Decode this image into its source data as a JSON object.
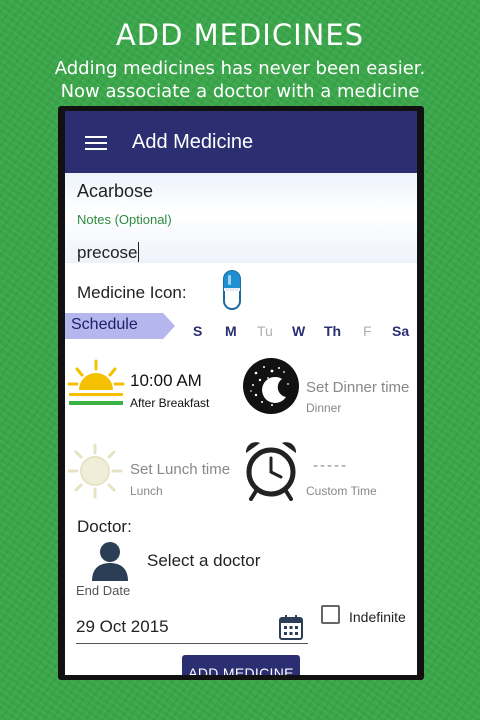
{
  "promo": {
    "title": "ADD MEDICINES",
    "subtitle_line1": "Adding medicines has never been easier.",
    "subtitle_line2": "Now associate a doctor with a medicine"
  },
  "appbar": {
    "menu_icon": "hamburger-menu-icon",
    "title": "Add Medicine",
    "color": "#2b2f72"
  },
  "form": {
    "medicine_name": "Acarbose",
    "notes_label": "Notes (Optional)",
    "notes_value": "precose",
    "medicine_icon_label": "Medicine Icon:",
    "medicine_icon": "capsule-icon"
  },
  "schedule": {
    "label": "Schedule",
    "days": [
      {
        "label": "S",
        "selected": true
      },
      {
        "label": "M",
        "selected": true
      },
      {
        "label": "Tu",
        "selected": false
      },
      {
        "label": "W",
        "selected": true
      },
      {
        "label": "Th",
        "selected": true
      },
      {
        "label": "F",
        "selected": false
      },
      {
        "label": "Sa",
        "selected": true
      }
    ]
  },
  "slots": {
    "breakfast": {
      "time": "10:00 AM",
      "sub": "After Breakfast",
      "icon": "sunrise-icon"
    },
    "dinner": {
      "time": "Set Dinner time",
      "sub": "Dinner",
      "icon": "moon-night-icon"
    },
    "lunch": {
      "time": "Set Lunch time",
      "sub": "Lunch",
      "icon": "sun-icon"
    },
    "custom": {
      "time": "-----",
      "sub": "Custom Time",
      "icon": "alarm-clock-icon"
    }
  },
  "doctor": {
    "label": "Doctor:",
    "select_text": "Select a doctor",
    "avatar_icon": "person-icon"
  },
  "end_date": {
    "label": "End Date",
    "value": "29 Oct 2015",
    "calendar_icon": "calendar-icon",
    "indefinite_label": "Indefinite",
    "indefinite_checked": false
  },
  "add_button": {
    "label": "ADD MEDICINE"
  }
}
